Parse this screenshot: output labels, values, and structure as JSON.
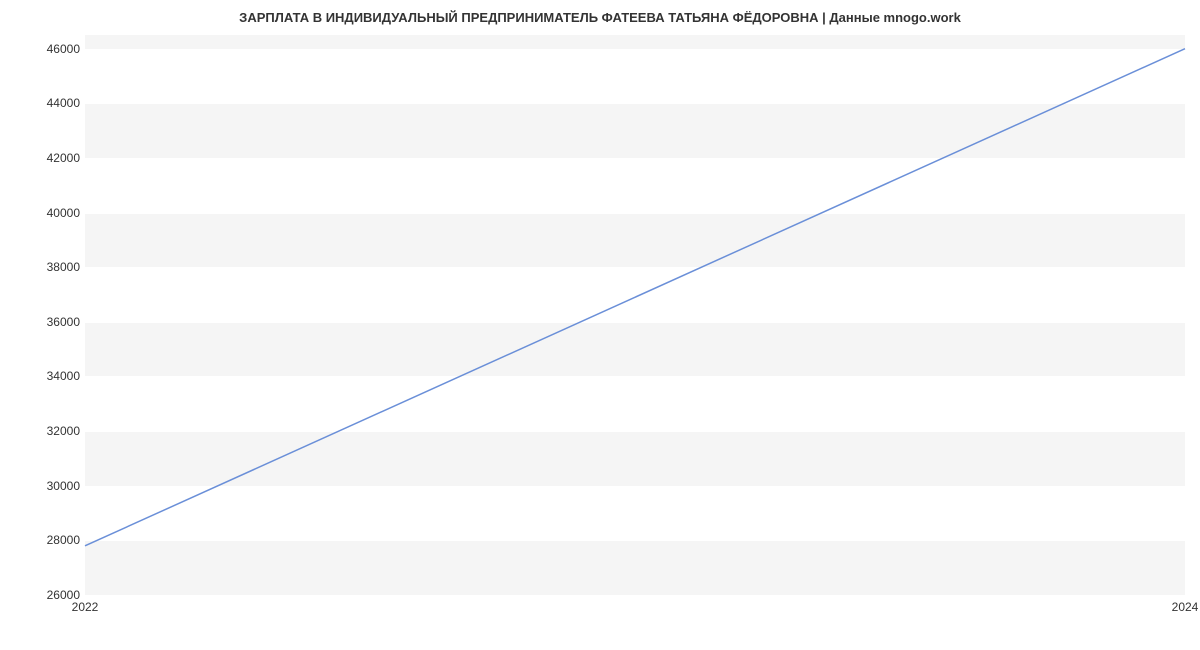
{
  "chart_data": {
    "type": "line",
    "title": "ЗАРПЛАТА В ИНДИВИДУАЛЬНЫЙ ПРЕДПРИНИМАТЕЛЬ ФАТЕЕВА ТАТЬЯНА ФЁДОРОВНА | Данные mnogo.work",
    "x": [
      2022,
      2024
    ],
    "values": [
      27800,
      46000
    ],
    "x_ticks": [
      "2022",
      "2024"
    ],
    "y_ticks": [
      "26000",
      "28000",
      "30000",
      "32000",
      "34000",
      "36000",
      "38000",
      "40000",
      "42000",
      "44000",
      "46000"
    ],
    "ylim": [
      26000,
      46500
    ],
    "xlim": [
      2022,
      2024
    ],
    "xlabel": "",
    "ylabel": "",
    "line_color": "#6a8fd8",
    "plot_bg": "#f5f5f5",
    "grid_color": "#ffffff"
  }
}
